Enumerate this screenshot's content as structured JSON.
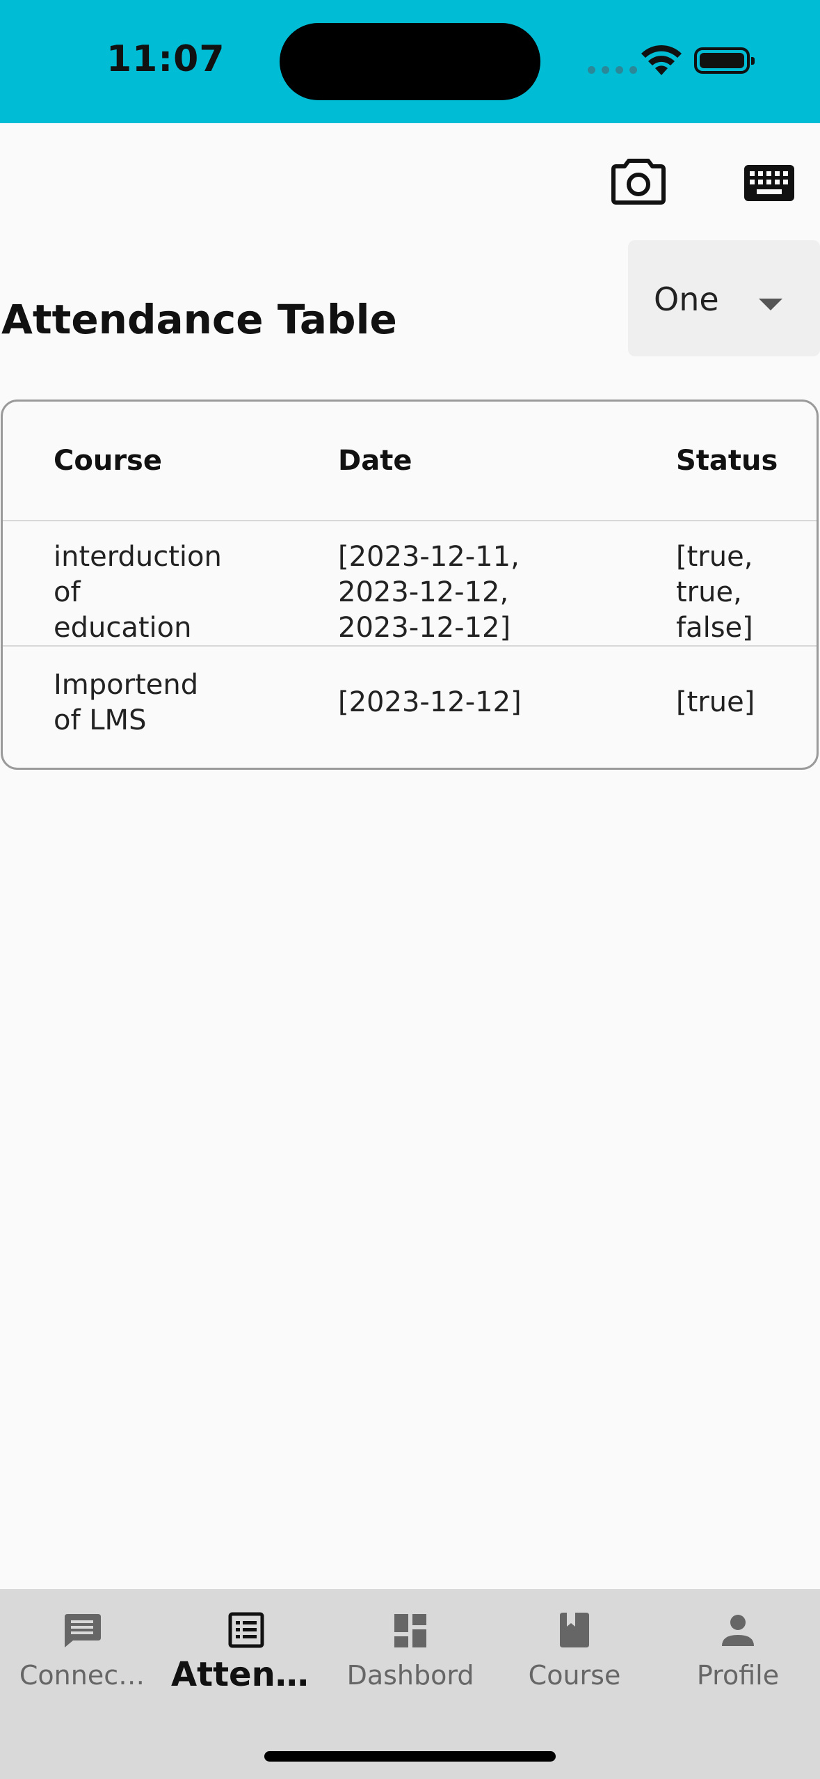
{
  "status_bar": {
    "time": "11:07",
    "bg_color": "#00bcd4"
  },
  "toolbar": {
    "camera_icon": "camera-icon",
    "keyboard_icon": "keyboard-icon"
  },
  "page": {
    "title": "Attendance Table"
  },
  "dropdown": {
    "selected": "One"
  },
  "table": {
    "headers": [
      "Course",
      "Date",
      "Status"
    ],
    "rows": [
      {
        "course": "interduction\nof\neducation",
        "date": "[2023-12-11,\n2023-12-12,\n2023-12-12]",
        "status": "[true,\ntrue,\nfalse]"
      },
      {
        "course": "Importend\nof LMS",
        "date": "[2023-12-12]",
        "status": "[true]"
      }
    ]
  },
  "bottom_nav": {
    "items": [
      {
        "label": "Connec…",
        "icon": "chat-icon"
      },
      {
        "label": "Attend…",
        "icon": "list-icon",
        "active": true
      },
      {
        "label": "Dashbord",
        "icon": "dashboard-icon"
      },
      {
        "label": "Course",
        "icon": "book-icon"
      },
      {
        "label": "Profile",
        "icon": "person-icon"
      }
    ]
  }
}
